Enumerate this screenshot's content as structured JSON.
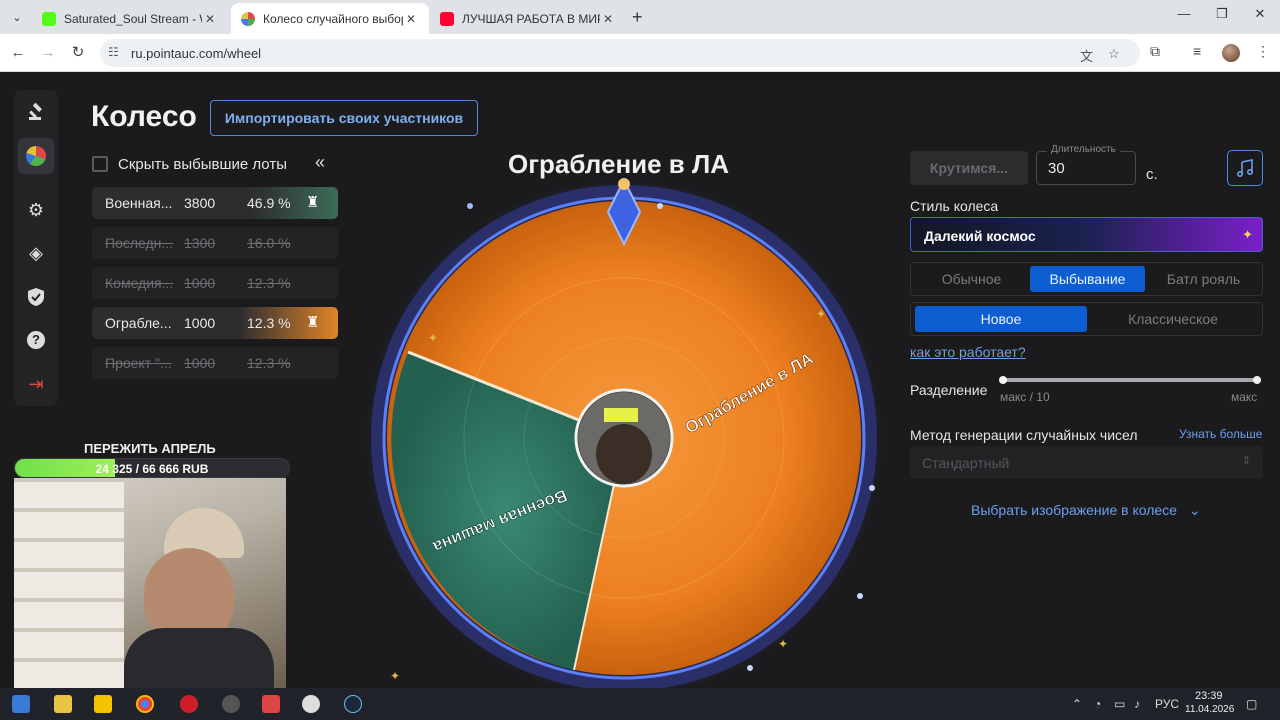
{
  "browser": {
    "tabs": [
      {
        "title": "Saturated_Soul Stream - Watch",
        "close": "✕"
      },
      {
        "title": "Колесо случайного выбора – Р",
        "close": "✕"
      },
      {
        "title": "ЛУЧШАЯ РАБОТА В МИРЕ | пр",
        "close": "✕"
      }
    ],
    "url": "ru.pointauc.com/wheel"
  },
  "page": {
    "title": "Колесо",
    "import_button": "Импортировать своих участников",
    "hide_out_label": "Скрыть выбывшие лоты",
    "collapse": "«"
  },
  "lots": [
    {
      "name": "Военная...",
      "amount": "3800",
      "percent": "46.9 %",
      "state": "active-green"
    },
    {
      "name": "Последн...",
      "amount": "1300",
      "percent": "16.0 %",
      "state": "out"
    },
    {
      "name": "Комедия...",
      "amount": "1000",
      "percent": "12.3 %",
      "state": "out"
    },
    {
      "name": "Ограбле...",
      "amount": "1000",
      "percent": "12.3 %",
      "state": "active-orange"
    },
    {
      "name": "Проект \"...",
      "amount": "1000",
      "percent": "12.3 %",
      "state": "out"
    }
  ],
  "wheel": {
    "title": "Ограбление в ЛА",
    "segments": [
      {
        "label": "Ограбление в ЛА",
        "color": "#ec7f1f"
      },
      {
        "label": "Военная машина",
        "color": "#2d7a64"
      }
    ]
  },
  "controls": {
    "spin_button": "Крутимся...",
    "duration_label": "Длительность",
    "duration_value": "30",
    "duration_unit": "с.",
    "style_label": "Стиль колеса",
    "style_value": "Далекий космос",
    "modes": [
      "Обычное",
      "Выбывание",
      "Батл рояль"
    ],
    "mode_selected": "Выбывание",
    "variants": [
      "Новое",
      "Классическое"
    ],
    "variant_selected": "Новое",
    "how_link": "как это работает?",
    "split_label": "Разделение",
    "split_min": "макс / 10",
    "split_max": "макс",
    "rng_label": "Метод генерации случайных чисел",
    "rng_link": "Узнать больше",
    "rng_value": "Стандартный",
    "pick_image": "Выбрать изображение в колесе"
  },
  "overlay": {
    "goal_title": "ПЕРЕЖИТЬ АПРЕЛЬ",
    "goal_text": "24 325 / 66 666 RUB",
    "goal_progress": 0.365
  },
  "taskbar": {
    "lang": "РУС",
    "time": "23:39",
    "date": "11.04.2026"
  },
  "colors": {
    "accent": "#0d5ed1",
    "link": "#6aa0ec",
    "orange_segment": "#ec7f1f",
    "green_segment": "#2d7a64"
  }
}
